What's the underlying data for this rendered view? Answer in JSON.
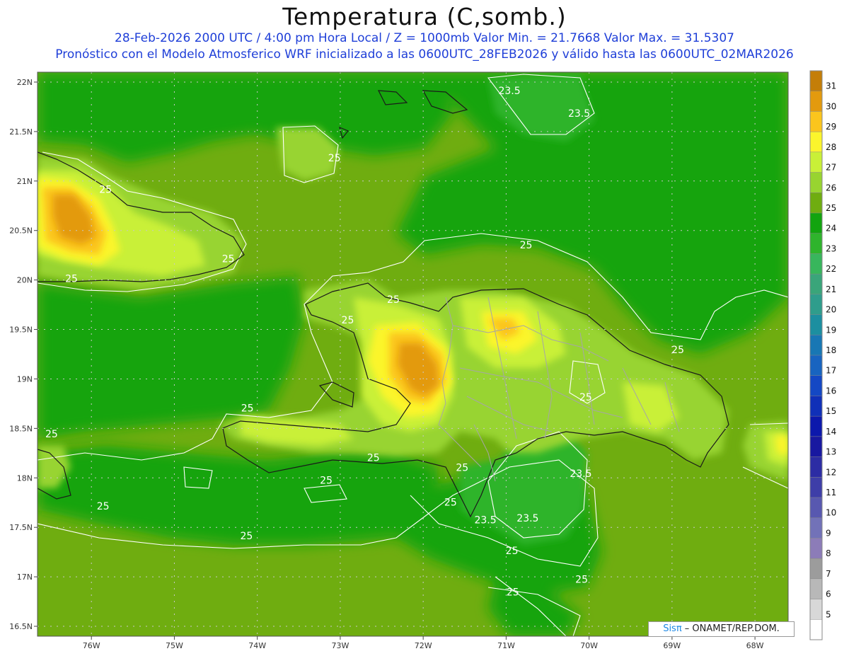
{
  "header": {
    "title": "Temperatura (C,somb.)",
    "line1": "28-Feb-2026  2000 UTC / 4:00 pm Hora Local / Z = 1000mb    Valor Min. = 21.7668  Valor Max. = 31.5307",
    "line2": "Pronóstico con el Modelo Atmosferico WRF inicializado a las 0600UTC_28FEB2026 y válido hasta las  0600UTC_02MAR2026"
  },
  "axes": {
    "lat_labels": [
      "22N",
      "21.5N",
      "21N",
      "20.5N",
      "20N",
      "19.5N",
      "19N",
      "18.5N",
      "18N",
      "17.5N",
      "17N",
      "16.5N"
    ],
    "lon_labels": [
      "76W",
      "75W",
      "74W",
      "73W",
      "72W",
      "71W",
      "70W",
      "69W",
      "68W"
    ],
    "lat_range": [
      16.4,
      22.1
    ],
    "lon_range": [
      -76.65,
      -67.6
    ]
  },
  "colorbar": {
    "labels": [
      "31",
      "30",
      "29",
      "28",
      "27",
      "26",
      "25",
      "24",
      "23",
      "22",
      "21",
      "20",
      "19",
      "18",
      "17",
      "16",
      "15",
      "14",
      "13",
      "12",
      "11",
      "10",
      "9",
      "8",
      "7",
      "6",
      "5"
    ],
    "colors": [
      "#c47e08",
      "#e39a0e",
      "#fbc51d",
      "#fbf52c",
      "#c9f037",
      "#98d430",
      "#6fad10",
      "#12a40f",
      "#2fb42c",
      "#38b65c",
      "#3aa57a",
      "#2f9d8c",
      "#1c8fa0",
      "#1877b4",
      "#1864c0",
      "#1448c4",
      "#1030b8",
      "#0c18ac",
      "#1818a0",
      "#2c2ca4",
      "#3e3ea8",
      "#5858b0",
      "#7272b8",
      "#8c7cb8",
      "#9c9c9c",
      "#b8b8b8",
      "#d8d8d8",
      "#ffffff"
    ]
  },
  "contour_labels": [
    {
      "text": "23.5",
      "lon": -70.96,
      "lat": 21.88
    },
    {
      "text": "23.5",
      "lon": -70.12,
      "lat": 21.65
    },
    {
      "text": "25",
      "lon": -73.07,
      "lat": 21.2
    },
    {
      "text": "25",
      "lon": -75.83,
      "lat": 20.88
    },
    {
      "text": "25",
      "lon": -74.35,
      "lat": 20.18
    },
    {
      "text": "25",
      "lon": -76.24,
      "lat": 19.98
    },
    {
      "text": "25",
      "lon": -70.76,
      "lat": 20.32
    },
    {
      "text": "25",
      "lon": -72.91,
      "lat": 19.56
    },
    {
      "text": "25",
      "lon": -72.36,
      "lat": 19.77
    },
    {
      "text": "25",
      "lon": -68.93,
      "lat": 19.26
    },
    {
      "text": "25",
      "lon": -70.04,
      "lat": 18.78
    },
    {
      "text": "25",
      "lon": -74.12,
      "lat": 18.67
    },
    {
      "text": "25",
      "lon": -76.48,
      "lat": 18.41
    },
    {
      "text": "25",
      "lon": -72.6,
      "lat": 18.17
    },
    {
      "text": "25",
      "lon": -71.53,
      "lat": 18.07
    },
    {
      "text": "25",
      "lon": -73.17,
      "lat": 17.94
    },
    {
      "text": "25",
      "lon": -71.67,
      "lat": 17.72
    },
    {
      "text": "25",
      "lon": -75.86,
      "lat": 17.68
    },
    {
      "text": "25",
      "lon": -74.13,
      "lat": 17.38
    },
    {
      "text": "25",
      "lon": -70.93,
      "lat": 17.23
    },
    {
      "text": "25",
      "lon": -70.09,
      "lat": 16.94
    },
    {
      "text": "25",
      "lon": -70.92,
      "lat": 16.81
    },
    {
      "text": "23.5",
      "lon": -70.1,
      "lat": 18.01
    },
    {
      "text": "23.5",
      "lon": -71.25,
      "lat": 17.54
    },
    {
      "text": "23.5",
      "lon": -70.74,
      "lat": 17.56
    }
  ],
  "credit": {
    "brand": "Sisπ",
    "text": " – ONAMET/REP.DOM."
  },
  "data_range": {
    "min": 21.7668,
    "max": 31.5307,
    "units": "C"
  }
}
